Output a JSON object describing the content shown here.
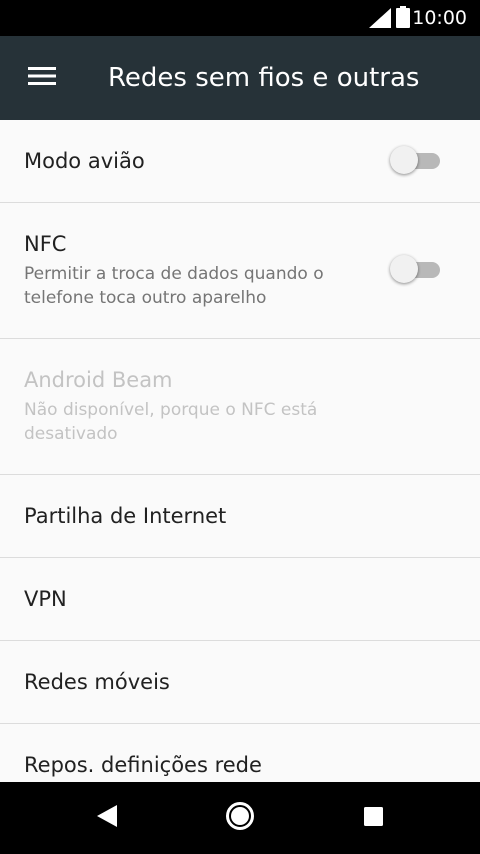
{
  "status_bar": {
    "time": "10:00",
    "signal_icon": "signal-icon",
    "battery_icon": "battery-icon"
  },
  "app_bar": {
    "title": "Redes sem fios e outras",
    "menu_icon": "hamburger-menu-icon",
    "color": "#263238"
  },
  "settings": {
    "airplane_mode": {
      "label": "Modo avião",
      "enabled": false
    },
    "nfc": {
      "label": "NFC",
      "summary": "Permitir a troca de dados quando o telefone toca outro aparelho",
      "enabled": false
    },
    "android_beam": {
      "label": "Android Beam",
      "summary": "Não disponível, porque o NFC está desativado",
      "disabled": true
    },
    "tethering": {
      "label": "Partilha de Internet"
    },
    "vpn": {
      "label": "VPN"
    },
    "mobile_networks": {
      "label": "Redes móveis"
    },
    "reset_network": {
      "label": "Repos. definições rede"
    }
  },
  "nav_bar": {
    "back_icon": "back-icon",
    "home_icon": "home-icon",
    "recents_icon": "recents-icon"
  }
}
